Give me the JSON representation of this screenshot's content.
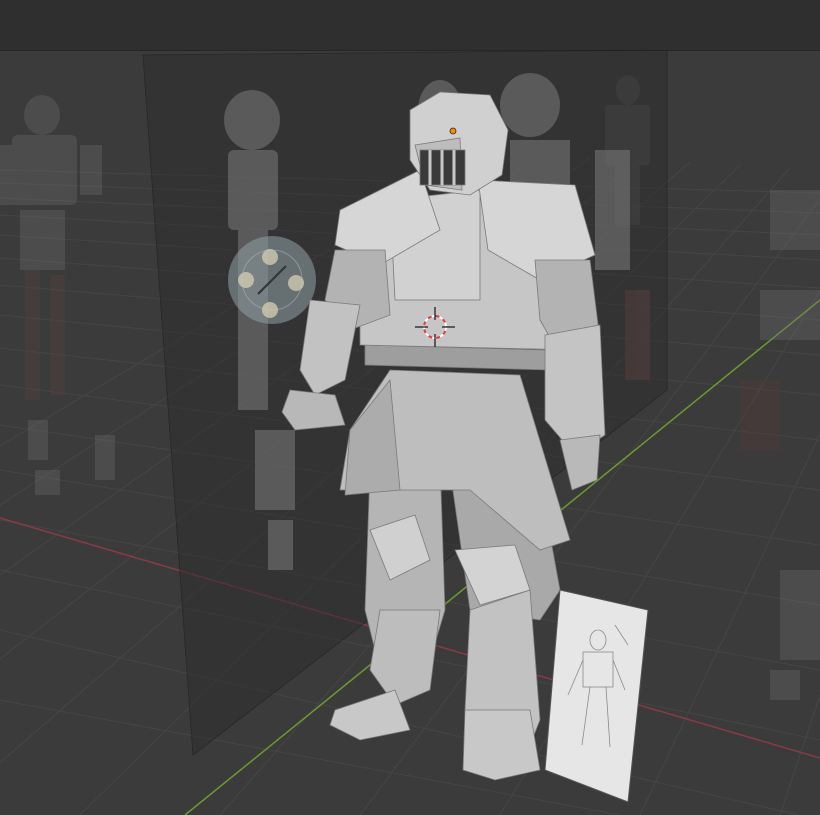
{
  "app": {
    "name": "",
    "view": ""
  },
  "colors": {
    "viewport_bg": "#3b3b3b",
    "header_bg": "#2f2f2f",
    "grid_line": "#474747",
    "x_axis": "#8a3a45",
    "y_axis": "#6c9a2e",
    "mesh_light": "#c9c9c9",
    "mesh_mid": "#a9a9a9",
    "mesh_dark": "#8a8a8a",
    "cursor_red": "#e04040",
    "origin_dot": "#ff8a00"
  },
  "icons": {
    "cursor": "3d-cursor-icon",
    "origin": "object-origin-icon"
  },
  "scene": {
    "objects": [
      "knight-mesh",
      "reference-image-side",
      "reference-image-sketch",
      "reference-ghost-left",
      "reference-ghost-right"
    ],
    "selected": "knight-mesh"
  }
}
